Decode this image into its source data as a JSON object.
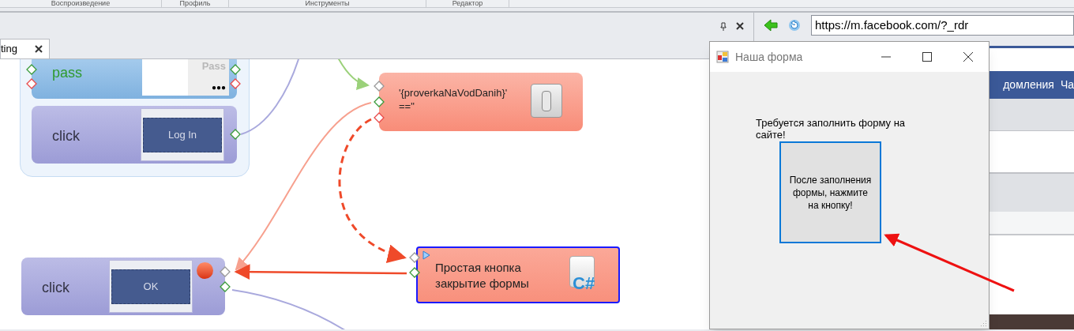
{
  "ribbon_groups": [
    "Воспроизведение",
    "Профиль",
    "Инструменты",
    "Редактор"
  ],
  "editor": {
    "tab": {
      "label": "ting",
      "selected": true
    },
    "nodes": [
      {
        "kind": "input",
        "label": "pass",
        "preview_label": "Pass",
        "preview_value": "●●●"
      },
      {
        "kind": "click",
        "label": "click",
        "preview_button": "Log In",
        "breakpoint": false
      },
      {
        "kind": "condition",
        "lines": [
          "'{proverkaNaVodDanih}'",
          "==\""
        ]
      },
      {
        "kind": "click",
        "label": "click",
        "preview_button": "OK",
        "breakpoint": true
      },
      {
        "kind": "code",
        "lines": [
          "Простая кнопка",
          "закрытие формы"
        ],
        "icon_label": "C#",
        "selected": true
      }
    ]
  },
  "browser": {
    "url": "https://m.facebook.com/?_rdr",
    "menu": [
      "домления",
      "Ча"
    ]
  },
  "dialog": {
    "title": "Наша форма",
    "message": "Требуется заполнить форму на сайте!",
    "button": "После заполнения формы, нажмите на кнопку!"
  }
}
